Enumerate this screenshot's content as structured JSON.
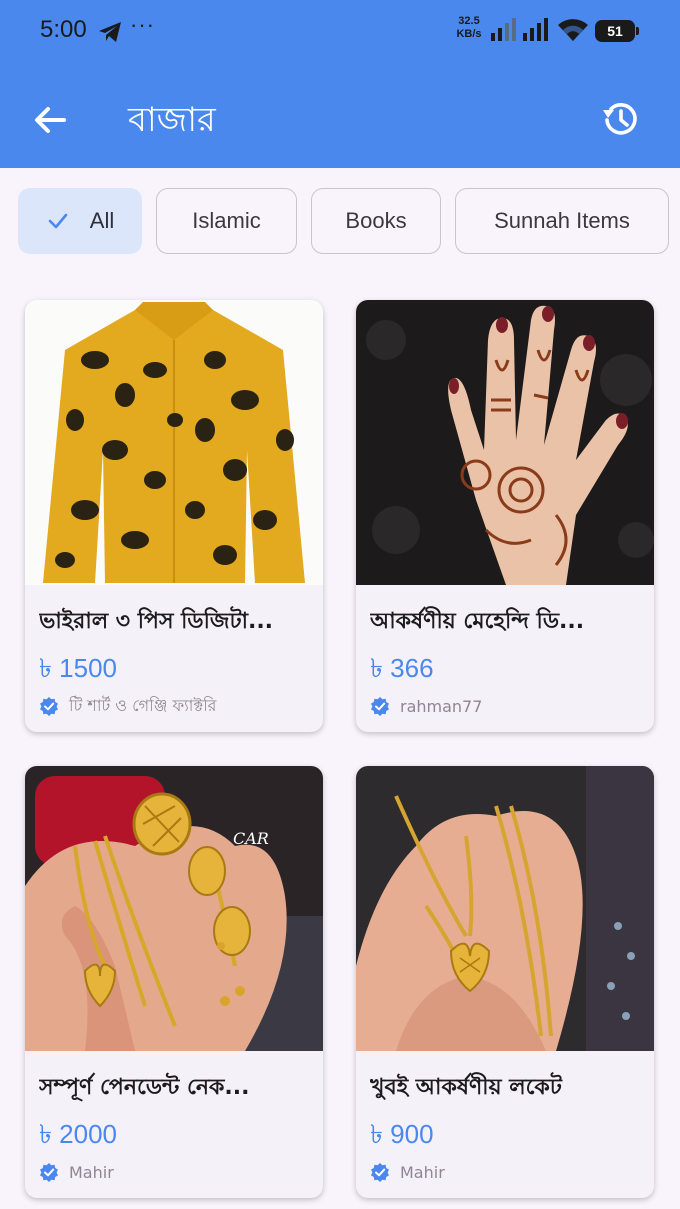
{
  "status_bar": {
    "time": "5:00",
    "more": "···",
    "speed_value": "32.5",
    "speed_unit": "KB/s",
    "battery": "51"
  },
  "app_bar": {
    "title": "বাজার",
    "back_icon": "arrow-back-icon",
    "history_icon": "history-icon",
    "color": "#4a88ee"
  },
  "filters": [
    {
      "label": "All",
      "selected": true
    },
    {
      "label": "Islamic",
      "selected": false
    },
    {
      "label": "Books",
      "selected": false
    },
    {
      "label": "Sunnah Items",
      "selected": false
    }
  ],
  "products": [
    {
      "title": "ভাইরাল ৩ পিস ডিজিটা...",
      "price": "৳ 1500",
      "seller": "টি শার্ট ও গেঞ্জি ফ্যাক্টরি",
      "verified": true
    },
    {
      "title": "আকর্ষণীয় মেহেন্দি ডি...",
      "price": "৳ 366",
      "seller": "rahman77",
      "verified": true
    },
    {
      "title": "সম্পূর্ণ পেনডেন্ট নেক...",
      "price": "৳ 2000",
      "seller": "Mahir",
      "verified": true
    },
    {
      "title": "খুবই আকর্ষণীয় লকেট",
      "price": "৳ 900",
      "seller": "Mahir",
      "verified": true
    }
  ],
  "image_watermark": "CAR",
  "colors": {
    "accent": "#4a88ee",
    "background": "#f9f3fb",
    "chip_selected": "#dce6fb"
  }
}
